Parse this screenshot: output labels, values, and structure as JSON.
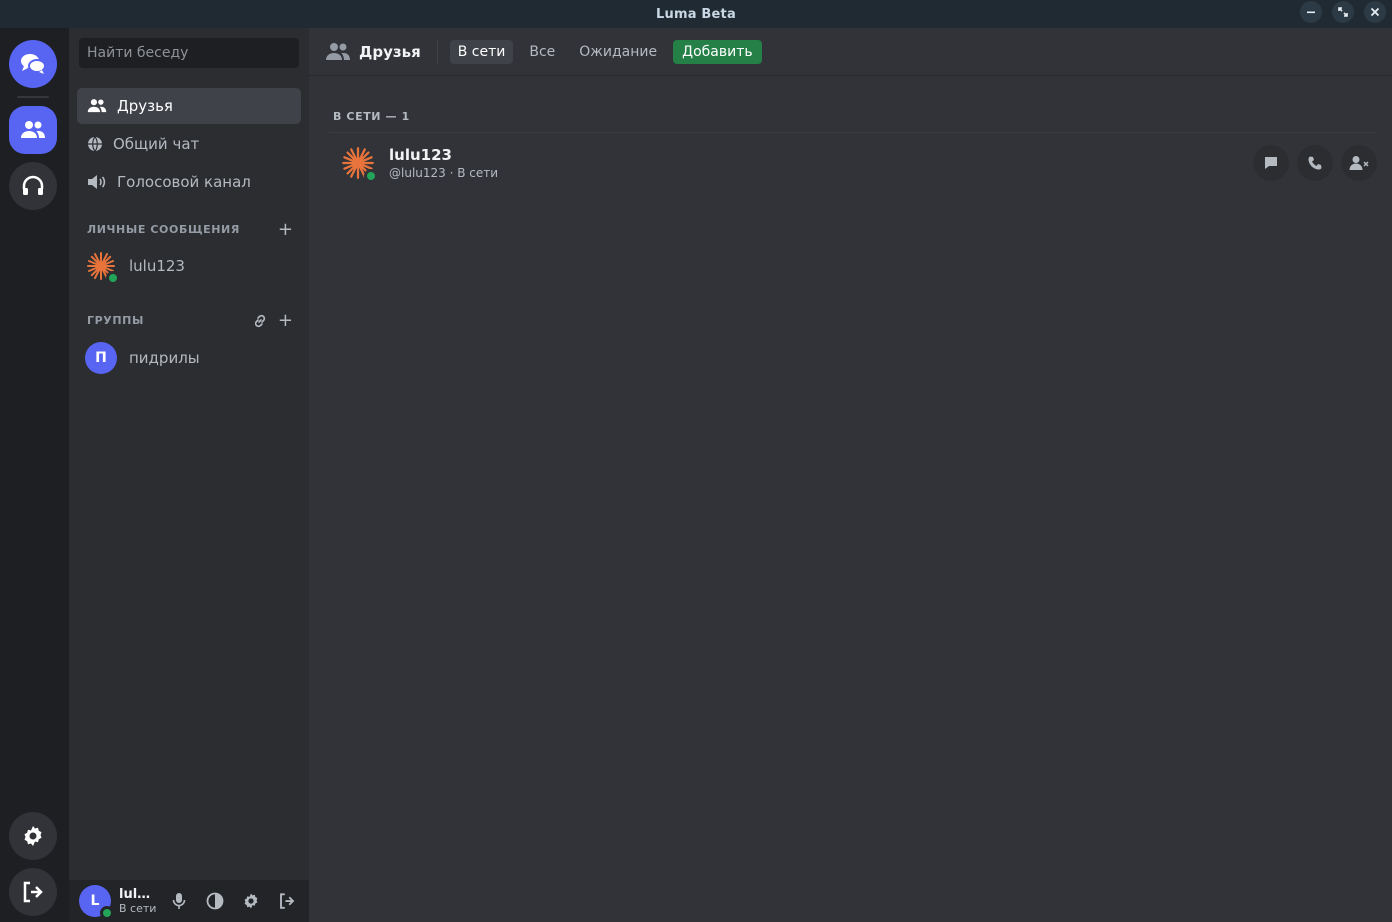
{
  "window": {
    "title": "Luma Beta"
  },
  "sidebar": {
    "search_placeholder": "Найти беседу",
    "nav": [
      {
        "label": "Друзья",
        "icon": "users-icon"
      },
      {
        "label": "Общий чат",
        "icon": "globe-icon"
      },
      {
        "label": "Голосовой канал",
        "icon": "speaker-icon"
      }
    ],
    "dm_section": {
      "label": "ЛИЧНЫЕ СООБЩЕНИЯ",
      "add": "+"
    },
    "dms": [
      {
        "name": "lulu123"
      }
    ],
    "groups_section": {
      "label": "ГРУППЫ",
      "add": "+"
    },
    "groups": [
      {
        "name": "пидрилы",
        "initial": "П"
      }
    ]
  },
  "user_panel": {
    "name": "lulu...",
    "status": "В сети",
    "initial": "L"
  },
  "header": {
    "title": "Друзья",
    "tabs": [
      {
        "label": "В сети",
        "active": true
      },
      {
        "label": "Все"
      },
      {
        "label": "Ожидание"
      },
      {
        "label": "Добавить"
      }
    ]
  },
  "friends": {
    "online_label": "В СЕТИ — 1",
    "list": [
      {
        "name": "lulu123",
        "subtitle": "@lulu123 · В сети"
      }
    ]
  },
  "colors": {
    "accent": "#5865f2",
    "online": "#23a559",
    "add": "#248046"
  }
}
